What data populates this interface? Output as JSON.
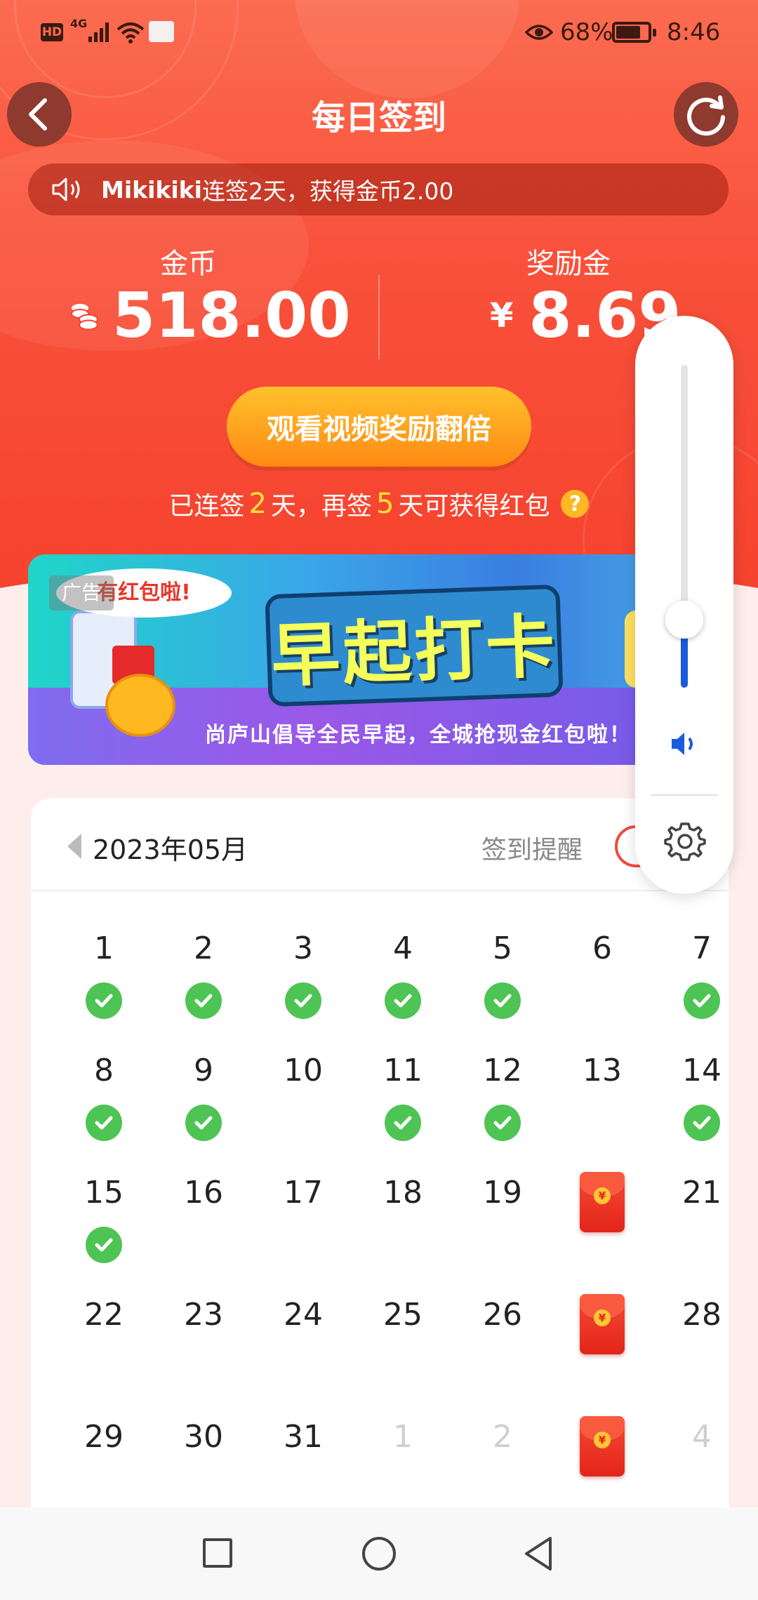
{
  "status_bar": {
    "hd": "HD",
    "network": "4G",
    "battery_percent": "68%",
    "time": "8:46",
    "icons": [
      "signal-icon",
      "wifi-icon",
      "app-notification-icon",
      "eye-icon",
      "battery-icon"
    ]
  },
  "header": {
    "title": "每日签到",
    "back_icon": "chevron-left-icon",
    "refresh_icon": "refresh-icon"
  },
  "notice": {
    "user": "Mikikiki",
    "text": "连签2天，获得金币2.00",
    "icon": "speaker-icon"
  },
  "balances": {
    "coins_label": "金币",
    "coins_value": "518.00",
    "reward_label": "奖励金",
    "reward_currency": "¥",
    "reward_value": "8.69"
  },
  "watch_button": {
    "label": "观看视频奖励翻倍"
  },
  "streak": {
    "prefix": "已连签",
    "days_signed": "2",
    "middle": "天，再签",
    "days_remaining": "5",
    "suffix": "天可获得红包",
    "help": "?"
  },
  "ad": {
    "tag": "广告",
    "bubble": "有红包啦!",
    "headline": "早起打卡",
    "slogan": "尚庐山倡导全民早起，全城抢现金红包啦！"
  },
  "calendar": {
    "month": "2023年05月",
    "remind_label": "签到提醒",
    "packet_glyph": "¥",
    "rows": [
      [
        {
          "d": "1",
          "s": "checked"
        },
        {
          "d": "2",
          "s": "checked"
        },
        {
          "d": "3",
          "s": "checked"
        },
        {
          "d": "4",
          "s": "checked"
        },
        {
          "d": "5",
          "s": "checked"
        },
        {
          "d": "6",
          "s": "none"
        },
        {
          "d": "7",
          "s": "checked"
        }
      ],
      [
        {
          "d": "8",
          "s": "checked"
        },
        {
          "d": "9",
          "s": "checked"
        },
        {
          "d": "10",
          "s": "none"
        },
        {
          "d": "11",
          "s": "checked"
        },
        {
          "d": "12",
          "s": "checked"
        },
        {
          "d": "13",
          "s": "none"
        },
        {
          "d": "14",
          "s": "checked"
        }
      ],
      [
        {
          "d": "15",
          "s": "checked"
        },
        {
          "d": "16",
          "s": "none"
        },
        {
          "d": "17",
          "s": "none"
        },
        {
          "d": "18",
          "s": "none"
        },
        {
          "d": "19",
          "s": "none"
        },
        {
          "d": "",
          "s": "red-packet"
        },
        {
          "d": "21",
          "s": "none"
        }
      ],
      [
        {
          "d": "22",
          "s": "none"
        },
        {
          "d": "23",
          "s": "none"
        },
        {
          "d": "24",
          "s": "none"
        },
        {
          "d": "25",
          "s": "none"
        },
        {
          "d": "26",
          "s": "none"
        },
        {
          "d": "",
          "s": "red-packet"
        },
        {
          "d": "28",
          "s": "none"
        }
      ],
      [
        {
          "d": "29",
          "s": "none"
        },
        {
          "d": "30",
          "s": "none"
        },
        {
          "d": "31",
          "s": "none"
        },
        {
          "d": "1",
          "s": "next-month"
        },
        {
          "d": "2",
          "s": "next-month"
        },
        {
          "d": "",
          "s": "red-packet"
        },
        {
          "d": "4",
          "s": "next-month"
        }
      ]
    ]
  },
  "volume_panel": {
    "level_fraction": 0.21,
    "icons": [
      "volume-icon",
      "settings-gear-icon"
    ]
  },
  "nav_bar": {
    "icons": [
      "recent-apps-icon",
      "home-icon",
      "back-triangle-icon"
    ]
  },
  "colors": {
    "header_gradient_top": "#fb6c50",
    "header_gradient_bottom": "#f5412c",
    "accent_yellow": "#ffe03a",
    "button_orange": "#ff8a14",
    "check_green": "#4dc453",
    "packet_red": "#e2251a",
    "volume_blue": "#1a5cdc"
  }
}
